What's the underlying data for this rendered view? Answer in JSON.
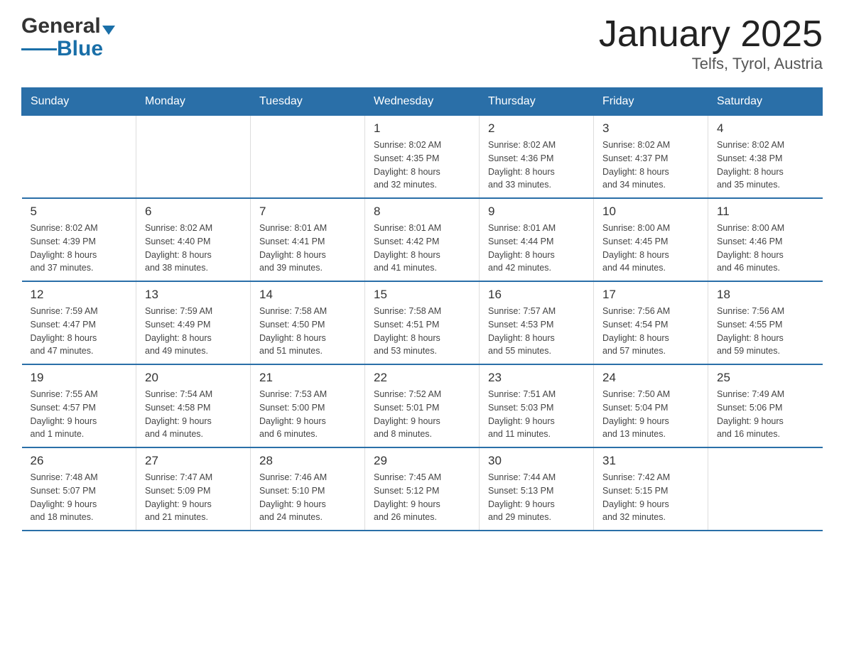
{
  "header": {
    "logo_general": "General",
    "logo_blue": "Blue",
    "title": "January 2025",
    "subtitle": "Telfs, Tyrol, Austria"
  },
  "days_of_week": [
    "Sunday",
    "Monday",
    "Tuesday",
    "Wednesday",
    "Thursday",
    "Friday",
    "Saturday"
  ],
  "weeks": [
    [
      {
        "day": "",
        "info": ""
      },
      {
        "day": "",
        "info": ""
      },
      {
        "day": "",
        "info": ""
      },
      {
        "day": "1",
        "info": "Sunrise: 8:02 AM\nSunset: 4:35 PM\nDaylight: 8 hours\nand 32 minutes."
      },
      {
        "day": "2",
        "info": "Sunrise: 8:02 AM\nSunset: 4:36 PM\nDaylight: 8 hours\nand 33 minutes."
      },
      {
        "day": "3",
        "info": "Sunrise: 8:02 AM\nSunset: 4:37 PM\nDaylight: 8 hours\nand 34 minutes."
      },
      {
        "day": "4",
        "info": "Sunrise: 8:02 AM\nSunset: 4:38 PM\nDaylight: 8 hours\nand 35 minutes."
      }
    ],
    [
      {
        "day": "5",
        "info": "Sunrise: 8:02 AM\nSunset: 4:39 PM\nDaylight: 8 hours\nand 37 minutes."
      },
      {
        "day": "6",
        "info": "Sunrise: 8:02 AM\nSunset: 4:40 PM\nDaylight: 8 hours\nand 38 minutes."
      },
      {
        "day": "7",
        "info": "Sunrise: 8:01 AM\nSunset: 4:41 PM\nDaylight: 8 hours\nand 39 minutes."
      },
      {
        "day": "8",
        "info": "Sunrise: 8:01 AM\nSunset: 4:42 PM\nDaylight: 8 hours\nand 41 minutes."
      },
      {
        "day": "9",
        "info": "Sunrise: 8:01 AM\nSunset: 4:44 PM\nDaylight: 8 hours\nand 42 minutes."
      },
      {
        "day": "10",
        "info": "Sunrise: 8:00 AM\nSunset: 4:45 PM\nDaylight: 8 hours\nand 44 minutes."
      },
      {
        "day": "11",
        "info": "Sunrise: 8:00 AM\nSunset: 4:46 PM\nDaylight: 8 hours\nand 46 minutes."
      }
    ],
    [
      {
        "day": "12",
        "info": "Sunrise: 7:59 AM\nSunset: 4:47 PM\nDaylight: 8 hours\nand 47 minutes."
      },
      {
        "day": "13",
        "info": "Sunrise: 7:59 AM\nSunset: 4:49 PM\nDaylight: 8 hours\nand 49 minutes."
      },
      {
        "day": "14",
        "info": "Sunrise: 7:58 AM\nSunset: 4:50 PM\nDaylight: 8 hours\nand 51 minutes."
      },
      {
        "day": "15",
        "info": "Sunrise: 7:58 AM\nSunset: 4:51 PM\nDaylight: 8 hours\nand 53 minutes."
      },
      {
        "day": "16",
        "info": "Sunrise: 7:57 AM\nSunset: 4:53 PM\nDaylight: 8 hours\nand 55 minutes."
      },
      {
        "day": "17",
        "info": "Sunrise: 7:56 AM\nSunset: 4:54 PM\nDaylight: 8 hours\nand 57 minutes."
      },
      {
        "day": "18",
        "info": "Sunrise: 7:56 AM\nSunset: 4:55 PM\nDaylight: 8 hours\nand 59 minutes."
      }
    ],
    [
      {
        "day": "19",
        "info": "Sunrise: 7:55 AM\nSunset: 4:57 PM\nDaylight: 9 hours\nand 1 minute."
      },
      {
        "day": "20",
        "info": "Sunrise: 7:54 AM\nSunset: 4:58 PM\nDaylight: 9 hours\nand 4 minutes."
      },
      {
        "day": "21",
        "info": "Sunrise: 7:53 AM\nSunset: 5:00 PM\nDaylight: 9 hours\nand 6 minutes."
      },
      {
        "day": "22",
        "info": "Sunrise: 7:52 AM\nSunset: 5:01 PM\nDaylight: 9 hours\nand 8 minutes."
      },
      {
        "day": "23",
        "info": "Sunrise: 7:51 AM\nSunset: 5:03 PM\nDaylight: 9 hours\nand 11 minutes."
      },
      {
        "day": "24",
        "info": "Sunrise: 7:50 AM\nSunset: 5:04 PM\nDaylight: 9 hours\nand 13 minutes."
      },
      {
        "day": "25",
        "info": "Sunrise: 7:49 AM\nSunset: 5:06 PM\nDaylight: 9 hours\nand 16 minutes."
      }
    ],
    [
      {
        "day": "26",
        "info": "Sunrise: 7:48 AM\nSunset: 5:07 PM\nDaylight: 9 hours\nand 18 minutes."
      },
      {
        "day": "27",
        "info": "Sunrise: 7:47 AM\nSunset: 5:09 PM\nDaylight: 9 hours\nand 21 minutes."
      },
      {
        "day": "28",
        "info": "Sunrise: 7:46 AM\nSunset: 5:10 PM\nDaylight: 9 hours\nand 24 minutes."
      },
      {
        "day": "29",
        "info": "Sunrise: 7:45 AM\nSunset: 5:12 PM\nDaylight: 9 hours\nand 26 minutes."
      },
      {
        "day": "30",
        "info": "Sunrise: 7:44 AM\nSunset: 5:13 PM\nDaylight: 9 hours\nand 29 minutes."
      },
      {
        "day": "31",
        "info": "Sunrise: 7:42 AM\nSunset: 5:15 PM\nDaylight: 9 hours\nand 32 minutes."
      },
      {
        "day": "",
        "info": ""
      }
    ]
  ]
}
